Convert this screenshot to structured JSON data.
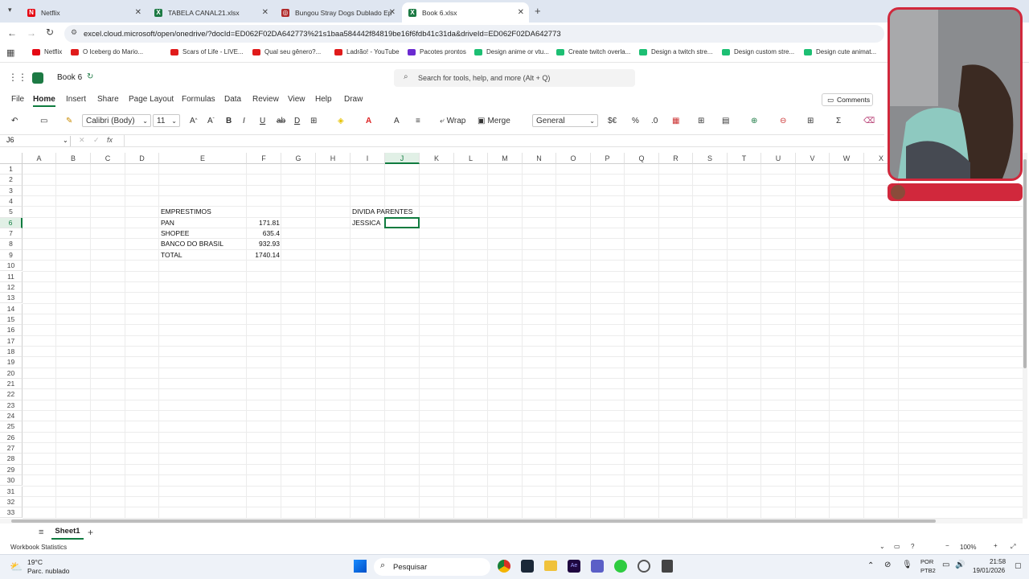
{
  "browser": {
    "tabs": [
      {
        "label": "Netflix",
        "favicon": "netflix-icon",
        "color": "#e50914",
        "glyph": "N",
        "active": false
      },
      {
        "label": "TABELA CANAL21.xlsx",
        "favicon": "excel-icon",
        "color": "#1d7a44",
        "glyph": "X",
        "active": false
      },
      {
        "label": "Bungou Stray Dogs Dublado Ep",
        "favicon": "anime-icon",
        "color": "#b02a2a",
        "glyph": "◎",
        "active": false
      },
      {
        "label": "Book 6.xlsx",
        "favicon": "excel-icon",
        "color": "#1d7a44",
        "glyph": "X",
        "active": true
      }
    ],
    "url": "excel.cloud.microsoft/open/onedrive/?docId=ED062F02DA642773%21s1baa584442f84819be16f6fdb41c31da&driveId=ED062F02DA642773",
    "bookmarks": [
      {
        "label": "Netflix",
        "color": "#e50914"
      },
      {
        "label": "O Iceberg do Mario...",
        "color": "#e01b1b"
      },
      {
        "label": "Scars of Life - LIVE...",
        "color": "#e01b1b"
      },
      {
        "label": "Qual seu gênero?...",
        "color": "#e01b1b"
      },
      {
        "label": "Ladrão! - YouTube",
        "color": "#e01b1b"
      },
      {
        "label": "Pacotes prontos",
        "color": "#6b2bd1"
      },
      {
        "label": "Design anime or vtu...",
        "color": "#1dbf73"
      },
      {
        "label": "Create twitch overla...",
        "color": "#1dbf73"
      },
      {
        "label": "Design a twitch stre...",
        "color": "#1dbf73"
      },
      {
        "label": "Design custom stre...",
        "color": "#1dbf73"
      },
      {
        "label": "Design cute animat...",
        "color": "#1dbf73"
      }
    ]
  },
  "app": {
    "title": "Book 6",
    "search_placeholder": "Search for tools, help, and more (Alt + Q)",
    "menu": [
      "File",
      "Home",
      "Insert",
      "Share",
      "Page Layout",
      "Formulas",
      "Data",
      "Review",
      "View",
      "Help",
      "Draw"
    ],
    "active_menu": "Home",
    "comments_label": "Comments",
    "ribbon": {
      "font": "Calibri (Body)",
      "size": "11",
      "wrap": "Wrap",
      "merge": "Merge",
      "number_format": "General"
    },
    "namebox": "J6",
    "formula_icon": "fx"
  },
  "grid": {
    "columns": [
      "A",
      "B",
      "C",
      "D",
      "E",
      "F",
      "G",
      "H",
      "I",
      "J",
      "K",
      "L",
      "M",
      "N",
      "O",
      "P",
      "Q",
      "R",
      "S",
      "T",
      "U",
      "V",
      "W",
      "X"
    ],
    "rows": [
      "1",
      "2",
      "3",
      "4",
      "5",
      "6",
      "7",
      "8",
      "9",
      "10",
      "11",
      "12",
      "13",
      "14",
      "15",
      "16",
      "17",
      "18",
      "19",
      "20",
      "21",
      "22",
      "23",
      "24",
      "25",
      "26",
      "27",
      "28",
      "29",
      "30",
      "31",
      "32",
      "33"
    ],
    "selected_column": "J",
    "selected_row": "6",
    "cells": {
      "E5": "EMPRESTIMOS",
      "E6": "PAN",
      "F6": "171.81",
      "E7": "SHOPEE",
      "F7": "635.4",
      "E8": "BANCO DO BRASIL",
      "F8": "932.93",
      "E9": "TOTAL",
      "F9": "1740.14",
      "I5": "DIVIDA PARENTES",
      "I6": "JESSICA"
    }
  },
  "sheet": {
    "tab": "Sheet1"
  },
  "status": {
    "left": "Workbook Statistics",
    "zoom": "100%"
  },
  "taskbar": {
    "weather_temp": "19°C",
    "weather_desc": "Parc. nublado",
    "search": "Pesquisar",
    "lang": "POR",
    "kbd": "PTB2",
    "time": "21:58",
    "date": "19/01/2026"
  }
}
